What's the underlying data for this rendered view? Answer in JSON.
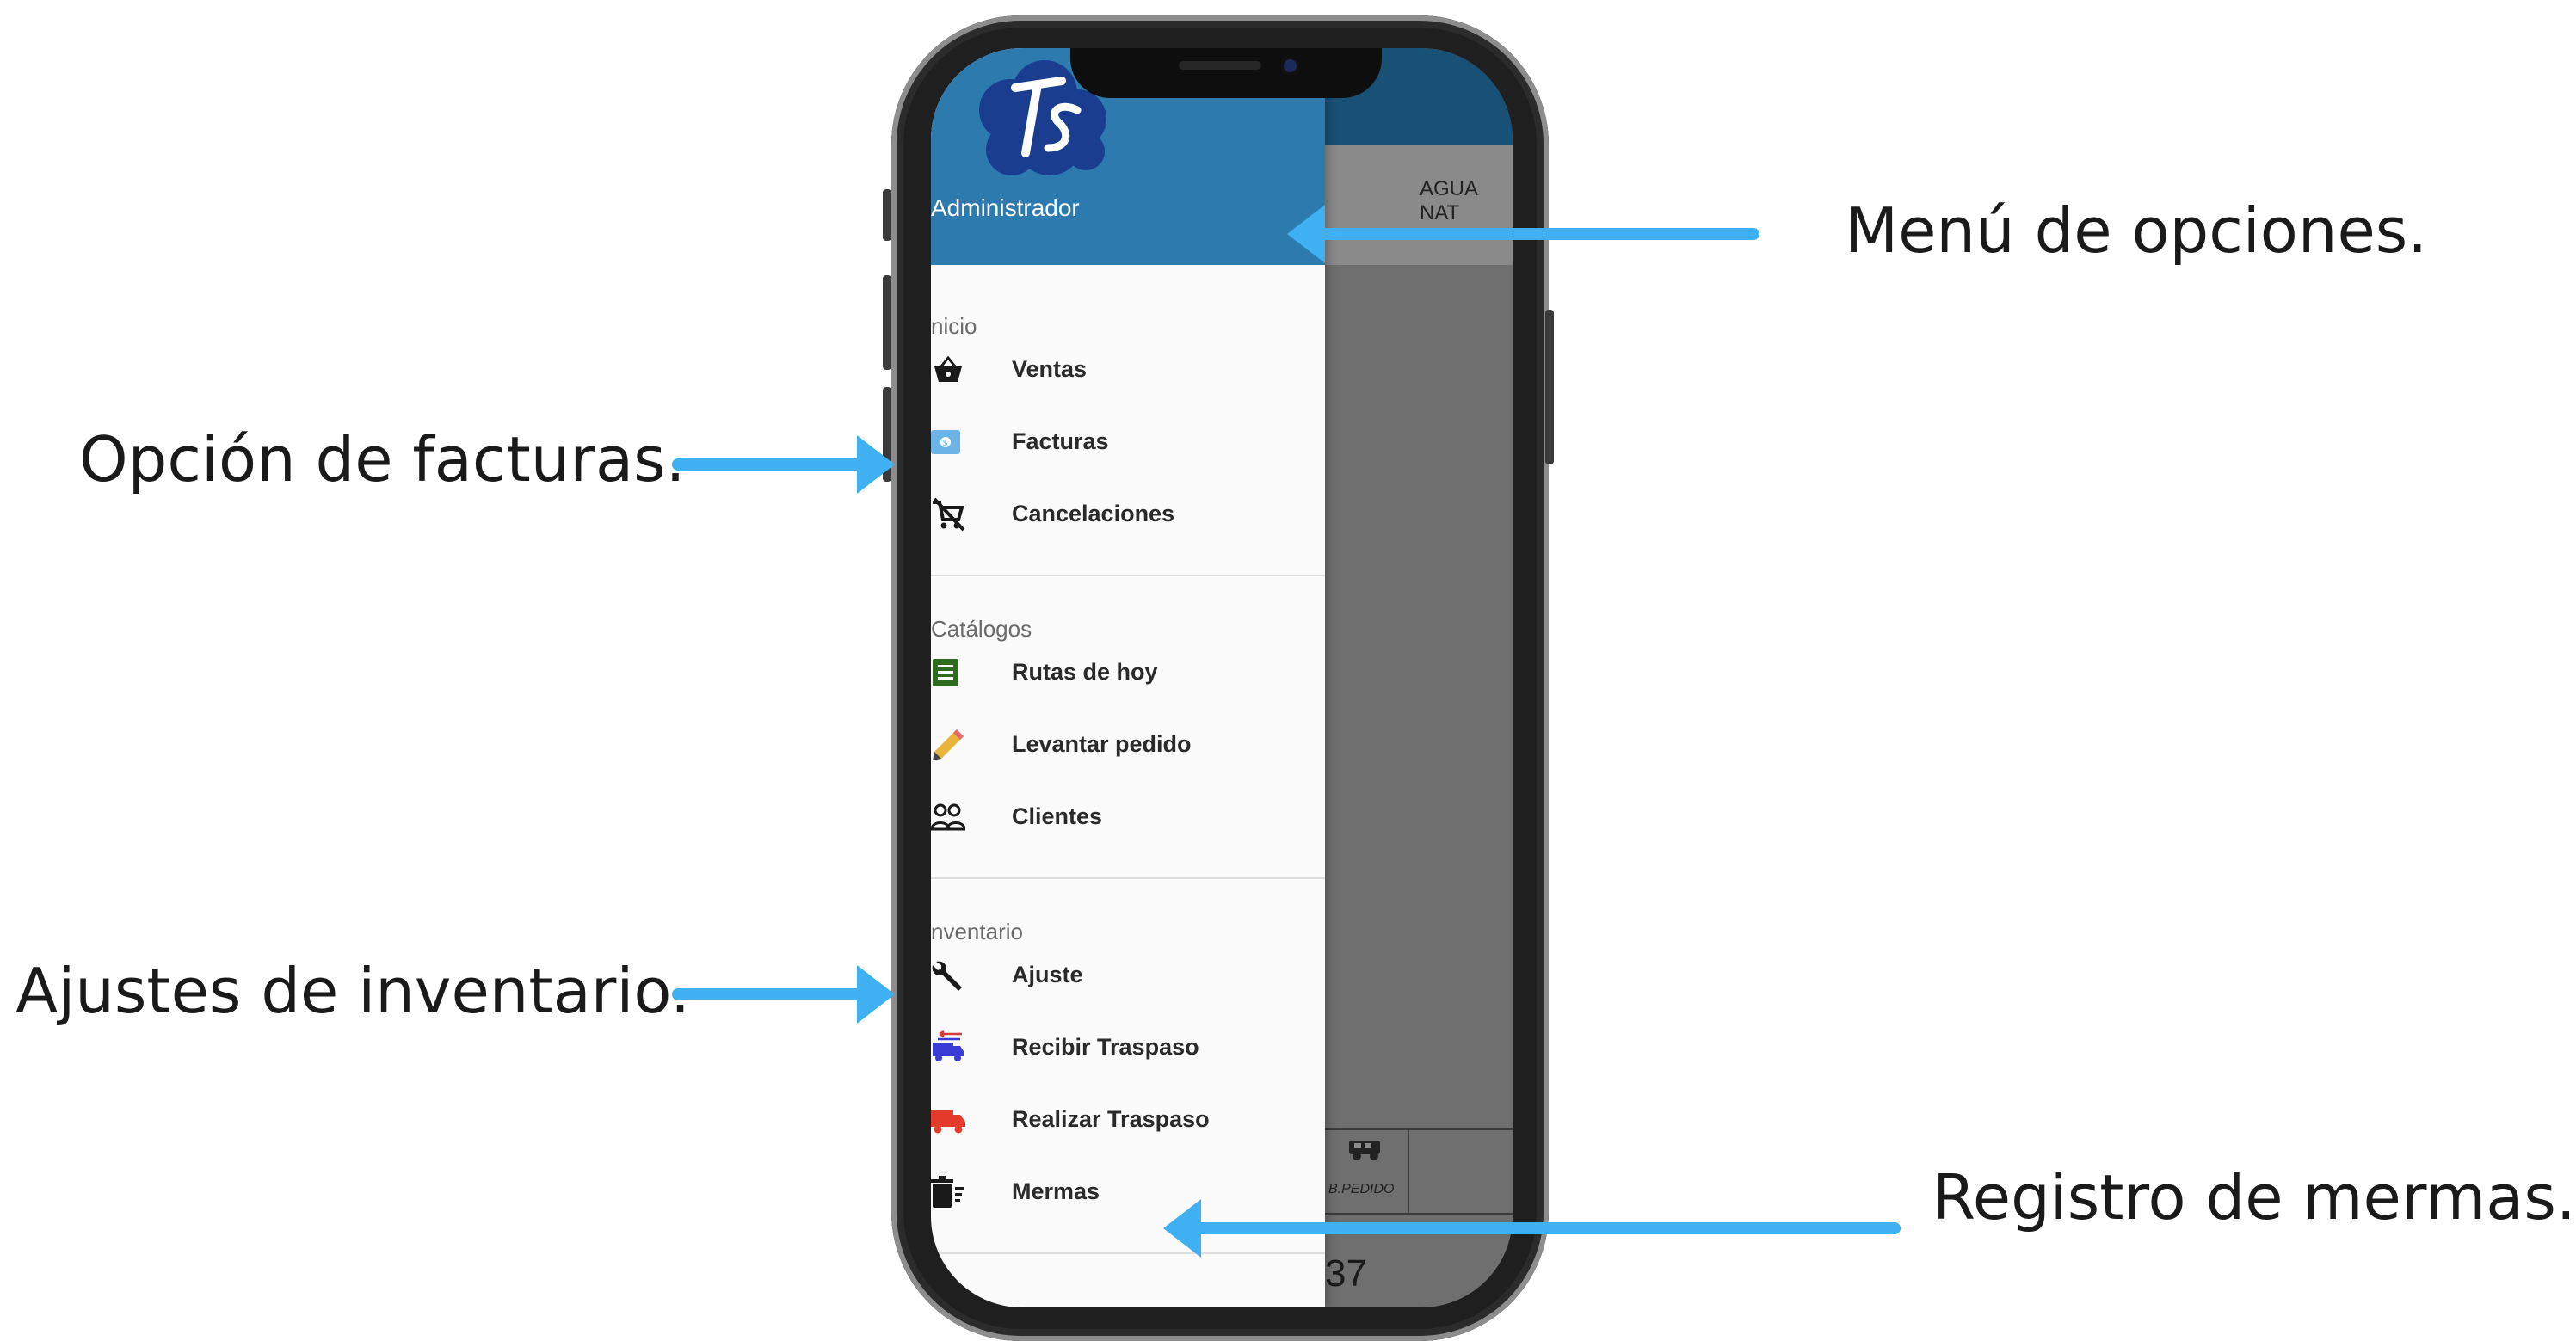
{
  "callouts": {
    "menu": "Menú de opciones.",
    "facturas": "Opción de facturas.",
    "inventario": "Ajustes de inventario.",
    "mermas": "Registro de mermas."
  },
  "colors": {
    "arrow": "#3fb0f2",
    "drawer_header": "#2d7aaf",
    "app_bar": "#195176"
  },
  "app": {
    "background": {
      "column_header": "AGUA NAT",
      "cell_label": "B.PEDIDO",
      "number_fragment": "37"
    },
    "drawer": {
      "header": {
        "role": "Administrador"
      },
      "sections": [
        {
          "title": "nicio",
          "items": [
            {
              "label": "Ventas",
              "icon": "basket-icon"
            },
            {
              "label": "Facturas",
              "icon": "invoice-icon"
            },
            {
              "label": "Cancelaciones",
              "icon": "cancel-cart-icon"
            }
          ]
        },
        {
          "title": "Catálogos",
          "items": [
            {
              "label": "Rutas de hoy",
              "icon": "list-icon"
            },
            {
              "label": "Levantar pedido",
              "icon": "pencil-icon"
            },
            {
              "label": "Clientes",
              "icon": "people-icon"
            }
          ]
        },
        {
          "title": "nventario",
          "items": [
            {
              "label": "Ajuste",
              "icon": "wrench-icon"
            },
            {
              "label": "Recibir Traspaso",
              "icon": "truck-receive-icon"
            },
            {
              "label": "Realizar Traspaso",
              "icon": "truck-send-icon"
            },
            {
              "label": "Mermas",
              "icon": "trash-icon"
            }
          ]
        }
      ]
    }
  }
}
